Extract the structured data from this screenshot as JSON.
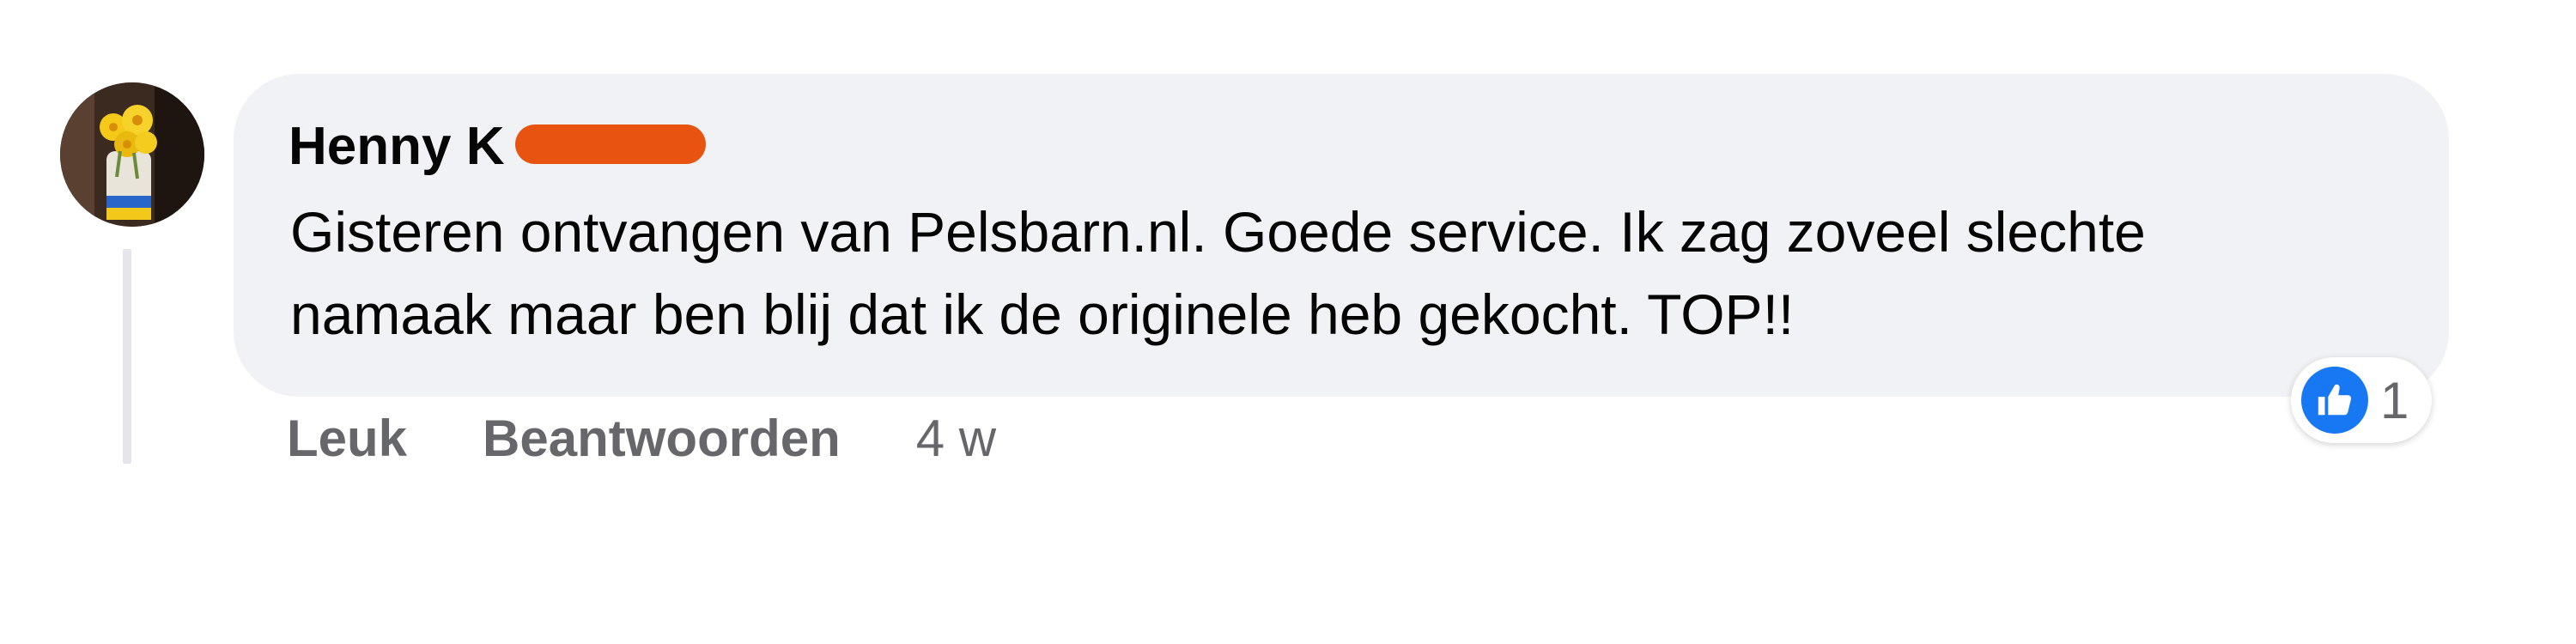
{
  "comment": {
    "author_name": "Henny K",
    "author_name_redacted": true,
    "text": "Gisteren ontvangen van Pelsbarn.nl. Goede service. Ik zag zoveel slechte\nnamaak maar ben blij dat ik de originele heb gekocht. TOP!!",
    "actions": {
      "like_label": "Leuk",
      "reply_label": "Beantwoorden",
      "timestamp": "4 w"
    },
    "reactions": {
      "icon": "thumbs-up-icon",
      "count": "1"
    }
  },
  "colors": {
    "bubble_background": "#f0f2f5",
    "reaction_blue": "#1877f2",
    "redaction": "#e8540f",
    "secondary_text": "#65676b",
    "primary_text": "#050505"
  }
}
